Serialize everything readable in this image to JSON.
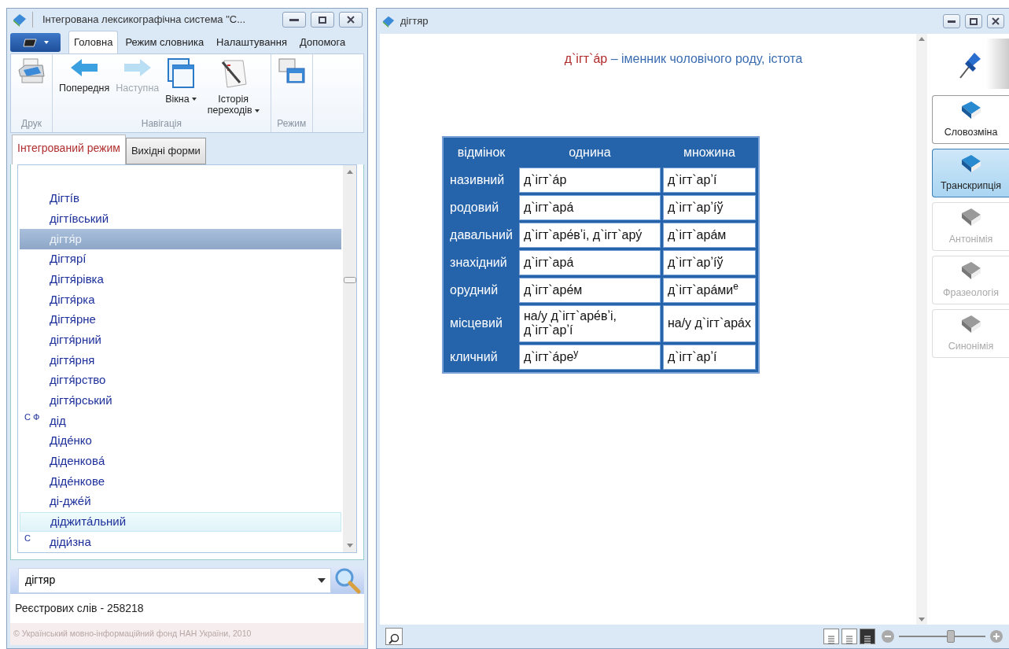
{
  "main_window": {
    "title": "Інтегрована лексикографічна система \"С..."
  },
  "ribbon": {
    "tabs": [
      {
        "label": "Головна",
        "selected": true
      },
      {
        "label": "Режим словника",
        "selected": false
      },
      {
        "label": "Налаштування",
        "selected": false
      },
      {
        "label": "Допомога",
        "selected": false
      }
    ],
    "groups": [
      {
        "label": "Друк",
        "buttons": [
          {
            "kind": "printer",
            "disabled": false,
            "dropdown": false
          }
        ]
      },
      {
        "label": "Навігація",
        "buttons": [
          {
            "kind": "back",
            "label": "Попередня",
            "disabled": false,
            "dropdown": false
          },
          {
            "kind": "forward",
            "label": "Наступна",
            "disabled": true,
            "dropdown": false
          },
          {
            "kind": "windows",
            "label": "Вікна",
            "disabled": false,
            "dropdown": true
          },
          {
            "kind": "history",
            "label": "Історія переходів",
            "disabled": false,
            "dropdown": true
          }
        ]
      },
      {
        "label": "Режим",
        "buttons": [
          {
            "kind": "mode",
            "disabled": false,
            "dropdown": false
          }
        ]
      }
    ]
  },
  "mode_tabs": [
    {
      "label": "Інтегрований режим",
      "selected": true
    },
    {
      "label": "Вихідні форми",
      "selected": false
    }
  ],
  "word_list": [
    {
      "word": "Дігтíв",
      "selected": false,
      "hovered": false
    },
    {
      "word": "дігтíвський",
      "selected": false,
      "hovered": false
    },
    {
      "word": "дігтя́р",
      "selected": true,
      "hovered": false
    },
    {
      "word": "Дігтярí",
      "selected": false,
      "hovered": false
    },
    {
      "word": "Дігтя́рівка",
      "selected": false,
      "hovered": false
    },
    {
      "word": "Дігтя́рка",
      "selected": false,
      "hovered": false
    },
    {
      "word": "Дігтя́рне",
      "selected": false,
      "hovered": false
    },
    {
      "word": "дігтя́рний",
      "selected": false,
      "hovered": false
    },
    {
      "word": "дігтя́рня",
      "selected": false,
      "hovered": false
    },
    {
      "word": "дігтя́рство",
      "selected": false,
      "hovered": false
    },
    {
      "word": "дігтя́рський",
      "selected": false,
      "hovered": false
    },
    {
      "word": "дід",
      "marks": "С Ф",
      "selected": false,
      "hovered": false
    },
    {
      "word": "Діде́нко",
      "selected": false,
      "hovered": false
    },
    {
      "word": "Діденковá",
      "selected": false,
      "hovered": false
    },
    {
      "word": "Діде́нкове",
      "selected": false,
      "hovered": false
    },
    {
      "word": "ді-дже́й",
      "selected": false,
      "hovered": false
    },
    {
      "word": "діджитáльний",
      "selected": false,
      "hovered": true
    },
    {
      "word": "діди́зна",
      "marks": "С",
      "selected": false,
      "hovered": false
    }
  ],
  "search": {
    "value": "дігтяр"
  },
  "word_count": "Реєстрових слів - 258218",
  "copyright": "© Український мовно-інформаційний фонд НАН України, 2010",
  "article_window": {
    "title": "дігтяр",
    "headword": "д`ігт`áр",
    "definition": "– іменник чоловічого роду, істота",
    "table": {
      "columns": [
        "відмінок",
        "однина",
        "множина"
      ],
      "rows": [
        [
          "називний",
          "д`ігт`áр",
          "д`ігт`арʼí"
        ],
        [
          "родовий",
          "д`ігт`арá",
          "д`ігт`арʼíў"
        ],
        [
          "давальний",
          "д`ігт`аре́вʼі, д`ігт`ару́",
          "д`ігт`арáм"
        ],
        [
          "знахідний",
          "д`ігт`арá",
          "д`ігт`арʼíў"
        ],
        [
          "орудний",
          "д`ігт`аре́м",
          "д`ігт`арáми$^{е}$"
        ],
        [
          "місцевий",
          "на/у д`ігт`аре́вʼі, д`ігт`арʼí",
          "на/у д`ігт`арáх"
        ],
        [
          "кличний",
          "д`ігт`áре$^{у}$",
          "д`ігт`арʼí"
        ]
      ]
    },
    "side_buttons": [
      {
        "label": "Словозміна",
        "selected": false,
        "disabled": false
      },
      {
        "label": "Транскрипція",
        "selected": true,
        "disabled": false
      },
      {
        "label": "Антонімія",
        "selected": false,
        "disabled": true
      },
      {
        "label": "Фразеологія",
        "selected": false,
        "disabled": true
      },
      {
        "label": "Синонімія",
        "selected": false,
        "disabled": true
      }
    ],
    "view_modes": [
      {
        "selected": false
      },
      {
        "selected": false
      },
      {
        "selected": true
      }
    ],
    "zoom": {
      "level": 0.6
    }
  }
}
